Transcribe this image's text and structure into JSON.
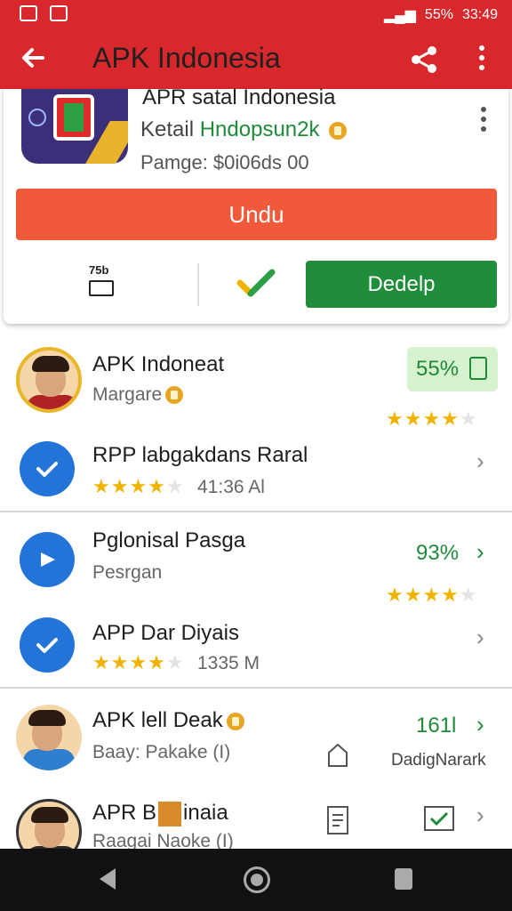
{
  "status_bar": {
    "battery": "55%",
    "time": "33:49"
  },
  "app_bar": {
    "title": "APK Indonesia"
  },
  "featured": {
    "name": "APR satal Indonesia",
    "developer_prefix": "Ketail",
    "developer_highlight": "Hndopsun2k",
    "meta": "Pamge: $0i06ds 00",
    "primary_button": "Undu",
    "size_label": "75b",
    "secondary_button": "Dedelp"
  },
  "list": [
    {
      "title": "APK Indoneat",
      "subtitle": "Margare",
      "chip": "55%",
      "rating": 4
    },
    {
      "title": "RPP labgakdans Raral",
      "meta": "41:36 Al",
      "rating": 4
    },
    {
      "title": "Pglonisal Pasga",
      "subtitle": "Pesrgan",
      "value": "93%",
      "rating": 4
    },
    {
      "title": "APP Dar Diyais",
      "meta": "1335 M",
      "rating": 4
    },
    {
      "title": "APK lell Deak",
      "subtitle": "Baay: Pakake (I)",
      "value": "161l",
      "label": "DadigNarark"
    },
    {
      "title": "APR B",
      "title_tail": "inaia",
      "subtitle": "Raagai Naoke (I)"
    }
  ],
  "colors": {
    "brand_red": "#d9282c",
    "accent_orange": "#f0593a",
    "accent_green": "#1f8d3a"
  }
}
